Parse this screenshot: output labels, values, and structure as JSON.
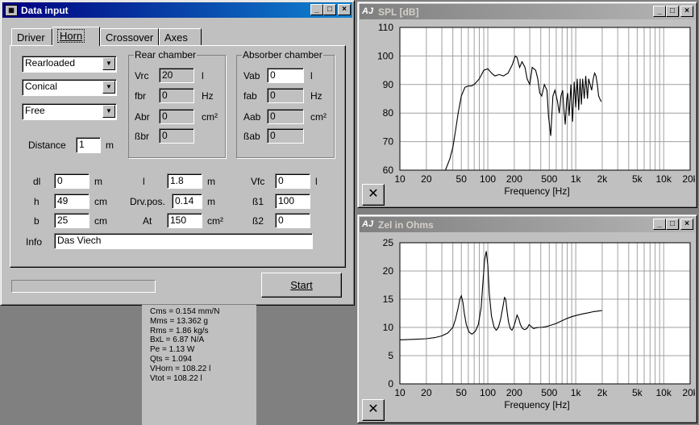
{
  "data_input": {
    "title": "Data input",
    "tabs": [
      "Driver",
      "Horn",
      "Crossover",
      "Axes"
    ],
    "combos": [
      "Rearloaded",
      "Conical",
      "Free"
    ],
    "distance": {
      "label": "Distance",
      "value": "1",
      "unit": "m"
    },
    "rear_chamber": {
      "title": "Rear chamber",
      "rows": [
        {
          "label": "Vrc",
          "value": "20",
          "unit": "l"
        },
        {
          "label": "fbr",
          "value": "0",
          "unit": "Hz"
        },
        {
          "label": "Abr",
          "value": "0",
          "unit": "cm²"
        },
        {
          "label": "ßbr",
          "value": "0",
          "unit": ""
        }
      ]
    },
    "absorber_chamber": {
      "title": "Absorber chamber",
      "rows": [
        {
          "label": "Vab",
          "value": "0",
          "unit": "l"
        },
        {
          "label": "fab",
          "value": "0",
          "unit": "Hz"
        },
        {
          "label": "Aab",
          "value": "0",
          "unit": "cm²"
        },
        {
          "label": "ßab",
          "value": "0",
          "unit": ""
        }
      ]
    },
    "params": {
      "dl": {
        "label": "dl",
        "value": "0",
        "unit": "m"
      },
      "h": {
        "label": "h",
        "value": "49",
        "unit": "cm"
      },
      "b": {
        "label": "b",
        "value": "25",
        "unit": "cm"
      },
      "l": {
        "label": "l",
        "value": "1.8",
        "unit": "m"
      },
      "drvpos": {
        "label": "Drv.pos.",
        "value": "0.14",
        "unit": "m"
      },
      "at": {
        "label": "At",
        "value": "150",
        "unit": "cm²"
      },
      "vfc": {
        "label": "Vfc",
        "value": "0",
        "unit": "l"
      },
      "b1": {
        "label": "ß1",
        "value": "100"
      },
      "b2": {
        "label": "ß2",
        "value": "0"
      }
    },
    "info": {
      "label": "Info",
      "value": "Das Viech"
    },
    "start_label": "Start",
    "progress": 0
  },
  "driver_info": [
    "Cms = 0.154 mm/N",
    "Mms = 13.362 g",
    "Rms = 1.86 kg/s",
    "BxL = 6.87 N/A",
    "Pe = 1.13 W",
    "Qts = 1.094",
    "VHorn = 108.22 l",
    "Vtot = 108.22 l"
  ],
  "spl_window": {
    "title": "SPL [dB]"
  },
  "zel_window": {
    "title": "Zel in Ohms"
  },
  "chart_data": [
    {
      "type": "line",
      "title": "SPL [dB]",
      "xlabel": "Frequency [Hz]",
      "ylabel": "",
      "x_scale": "log",
      "xlim": [
        10,
        20000
      ],
      "ylim": [
        60,
        110
      ],
      "x_ticks": [
        "10",
        "20",
        "50",
        "100",
        "200",
        "500",
        "1k",
        "2k",
        "5k",
        "10k",
        "20k"
      ],
      "y_ticks": [
        "110",
        "100",
        "90",
        "80",
        "70",
        "60"
      ],
      "grid": true,
      "series": [
        {
          "x": [
            33,
            37,
            40,
            43,
            46,
            50,
            55,
            60,
            65,
            70,
            80,
            90,
            100,
            110,
            120,
            135,
            150,
            170,
            190,
            205,
            215,
            230,
            245,
            265,
            280,
            300,
            320,
            350,
            370,
            390,
            410,
            440,
            470,
            490,
            520,
            550,
            580,
            620,
            650,
            680,
            710,
            730,
            760,
            790,
            810,
            840,
            880,
            920,
            960,
            1000,
            1040,
            1080,
            1120,
            1160,
            1200,
            1250,
            1300,
            1360,
            1400,
            1460,
            1520,
            1580,
            1640,
            1700,
            1760,
            1820,
            1880,
            1950
          ],
          "y": [
            60,
            64,
            68,
            74,
            80,
            86,
            89,
            89.5,
            89.5,
            90,
            92,
            95,
            95.5,
            94,
            93,
            93.5,
            93,
            94,
            97,
            100,
            99.5,
            96,
            98,
            96,
            92,
            90,
            96,
            95,
            92,
            87,
            86,
            90,
            88,
            79,
            72,
            86,
            88,
            84,
            80,
            86,
            88,
            82,
            76,
            85,
            87,
            79,
            90,
            77,
            91,
            82,
            92,
            81,
            92,
            83,
            92,
            85,
            93,
            85,
            92,
            90,
            88,
            92,
            94,
            93,
            90,
            86,
            85,
            84
          ]
        }
      ]
    },
    {
      "type": "line",
      "title": "Zel in Ohms",
      "xlabel": "Frequency [Hz]",
      "ylabel": "",
      "x_scale": "log",
      "xlim": [
        10,
        20000
      ],
      "ylim": [
        0,
        25
      ],
      "x_ticks": [
        "10",
        "20",
        "50",
        "100",
        "200",
        "500",
        "1k",
        "2k",
        "5k",
        "10k",
        "20k"
      ],
      "y_ticks": [
        "25",
        "20",
        "15",
        "10",
        "5",
        "0"
      ],
      "grid": true,
      "series": [
        {
          "x": [
            10,
            15,
            20,
            25,
            30,
            35,
            40,
            43,
            46,
            48,
            50,
            52,
            54,
            57,
            61,
            66,
            72,
            78,
            84,
            88,
            92,
            96,
            100,
            104,
            110,
            118,
            125,
            132,
            140,
            148,
            155,
            160,
            165,
            172,
            180,
            188,
            196,
            205,
            215,
            225,
            235,
            248,
            262,
            278,
            295,
            310,
            330,
            350,
            375,
            400,
            450,
            500,
            600,
            700,
            800,
            900,
            1000,
            1200,
            1400,
            1600,
            1800,
            2000
          ],
          "y": [
            7.8,
            7.9,
            8.0,
            8.2,
            8.5,
            9.0,
            10,
            11.5,
            13.5,
            15,
            15.6,
            14.5,
            12.5,
            10.5,
            9.2,
            8.8,
            9.3,
            10.5,
            13.5,
            18,
            22,
            23.5,
            21,
            16,
            12,
            10,
            9.5,
            10,
            11.5,
            13.5,
            15.3,
            15,
            13,
            11,
            9.8,
            9.5,
            10,
            11,
            12.2,
            11.5,
            10.5,
            9.8,
            9.6,
            9.8,
            10.5,
            10.2,
            9.8,
            9.9,
            10,
            10,
            10.1,
            10.3,
            10.7,
            11.2,
            11.6,
            11.9,
            12.1,
            12.4,
            12.6,
            12.8,
            12.9,
            13.0
          ]
        }
      ]
    }
  ]
}
